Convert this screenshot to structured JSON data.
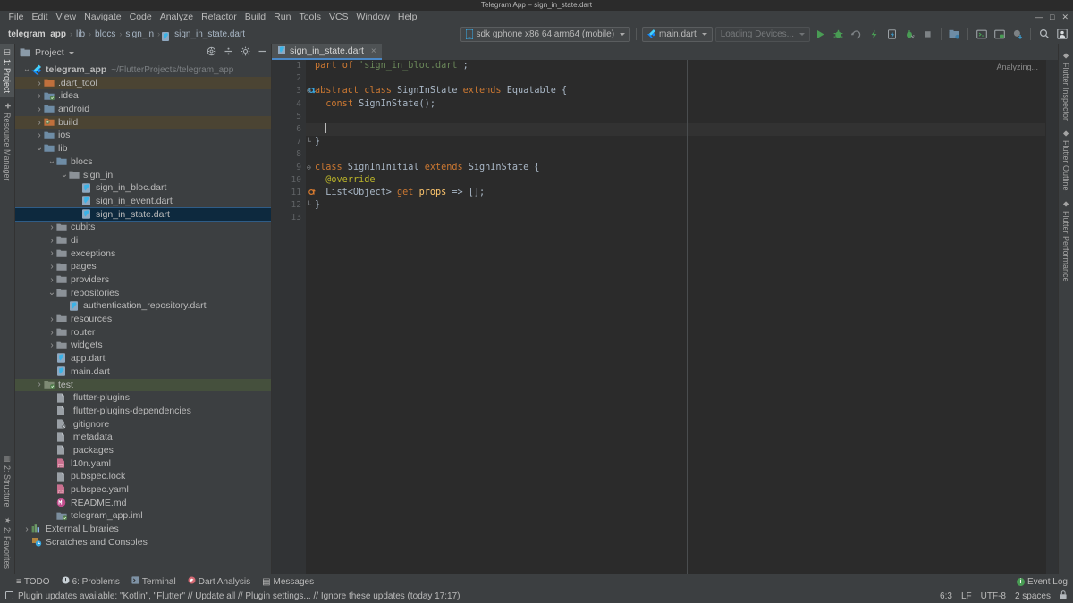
{
  "window": {
    "title": "Telegram App – sign_in_state.dart",
    "controls": [
      "minimize",
      "maximize",
      "close"
    ]
  },
  "menubar": {
    "items": [
      "File",
      "Edit",
      "View",
      "Navigate",
      "Code",
      "Analyze",
      "Refactor",
      "Build",
      "Run",
      "Tools",
      "VCS",
      "Window",
      "Help"
    ]
  },
  "breadcrumb": {
    "items": [
      "telegram_app",
      "lib",
      "blocs",
      "sign_in",
      "sign_in_state.dart"
    ],
    "separator": "›"
  },
  "toolbar": {
    "device_selector": "sdk gphone x86 64 arm64 (mobile)",
    "run_config": "main.dart",
    "devices_status": "Loading Devices...",
    "icons": [
      "run-icon",
      "debug-icon",
      "debug-reattach-icon",
      "hot-reload-icon",
      "open-devtools-icon",
      "profile-icon",
      "stop-icon",
      "project-structure-icon",
      "terminal-icon",
      "flutter-inspector-icon",
      "update-project-icon",
      "search-everywhere-icon",
      "account-icon"
    ]
  },
  "left_rail": {
    "top": [
      {
        "label": "1: Project",
        "icon": "project-icon",
        "active": true
      },
      {
        "label": "Resource Manager",
        "icon": "resource-icon",
        "active": false
      }
    ],
    "bottom": [
      {
        "label": "2: Structure",
        "icon": "structure-icon"
      },
      {
        "label": "2: Favorites",
        "icon": "star-icon"
      }
    ]
  },
  "right_rail": {
    "items": [
      {
        "label": "Flutter Inspector",
        "icon": "flutter-icon"
      },
      {
        "label": "Flutter Outline",
        "icon": "flutter-icon"
      },
      {
        "label": "Flutter Performance",
        "icon": "flutter-icon"
      }
    ]
  },
  "project_panel": {
    "title": "Project",
    "tools": [
      "collapse-scope-icon",
      "collapse-all-icon",
      "settings-icon",
      "hide-icon"
    ],
    "tree": [
      {
        "label": "telegram_app",
        "sub": "~/FlutterProjects/telegram_app",
        "depth": 0,
        "arrow": "open",
        "icon": "flutter-project-icon",
        "bold": true,
        "highlight": ""
      },
      {
        "label": ".dart_tool",
        "depth": 1,
        "arrow": "closed",
        "icon": "folder-orange",
        "highlight": "brown"
      },
      {
        "label": ".idea",
        "depth": 1,
        "arrow": "closed",
        "icon": "folder-module",
        "highlight": ""
      },
      {
        "label": "android",
        "depth": 1,
        "arrow": "closed",
        "icon": "folder-blue",
        "highlight": ""
      },
      {
        "label": "build",
        "depth": 1,
        "arrow": "closed",
        "icon": "folder-orange-excluded",
        "highlight": "brown"
      },
      {
        "label": "ios",
        "depth": 1,
        "arrow": "closed",
        "icon": "folder-blue",
        "highlight": ""
      },
      {
        "label": "lib",
        "depth": 1,
        "arrow": "open",
        "icon": "folder-blue",
        "highlight": ""
      },
      {
        "label": "blocs",
        "depth": 2,
        "arrow": "open",
        "icon": "folder-blue",
        "highlight": ""
      },
      {
        "label": "sign_in",
        "depth": 3,
        "arrow": "open",
        "icon": "folder-gray",
        "highlight": ""
      },
      {
        "label": "sign_in_bloc.dart",
        "depth": 4,
        "arrow": "",
        "icon": "dart-file",
        "highlight": ""
      },
      {
        "label": "sign_in_event.dart",
        "depth": 4,
        "arrow": "",
        "icon": "dart-file",
        "highlight": ""
      },
      {
        "label": "sign_in_state.dart",
        "depth": 4,
        "arrow": "",
        "icon": "dart-file",
        "highlight": "",
        "selected": true
      },
      {
        "label": "cubits",
        "depth": 2,
        "arrow": "closed",
        "icon": "folder-gray",
        "highlight": ""
      },
      {
        "label": "di",
        "depth": 2,
        "arrow": "closed",
        "icon": "folder-gray",
        "highlight": ""
      },
      {
        "label": "exceptions",
        "depth": 2,
        "arrow": "closed",
        "icon": "folder-gray",
        "highlight": ""
      },
      {
        "label": "pages",
        "depth": 2,
        "arrow": "closed",
        "icon": "folder-gray",
        "highlight": ""
      },
      {
        "label": "providers",
        "depth": 2,
        "arrow": "closed",
        "icon": "folder-gray",
        "highlight": ""
      },
      {
        "label": "repositories",
        "depth": 2,
        "arrow": "open",
        "icon": "folder-gray",
        "highlight": ""
      },
      {
        "label": "authentication_repository.dart",
        "depth": 3,
        "arrow": "",
        "icon": "dart-file",
        "highlight": ""
      },
      {
        "label": "resources",
        "depth": 2,
        "arrow": "closed",
        "icon": "folder-gray",
        "highlight": ""
      },
      {
        "label": "router",
        "depth": 2,
        "arrow": "closed",
        "icon": "folder-gray",
        "highlight": ""
      },
      {
        "label": "widgets",
        "depth": 2,
        "arrow": "closed",
        "icon": "folder-gray",
        "highlight": ""
      },
      {
        "label": "app.dart",
        "depth": 2,
        "arrow": "",
        "icon": "dart-file",
        "highlight": ""
      },
      {
        "label": "main.dart",
        "depth": 2,
        "arrow": "",
        "icon": "dart-file",
        "highlight": ""
      },
      {
        "label": "test",
        "depth": 1,
        "arrow": "closed",
        "icon": "folder-test",
        "highlight": "green"
      },
      {
        "label": ".flutter-plugins",
        "depth": 2,
        "arrow": "",
        "icon": "text-file",
        "highlight": ""
      },
      {
        "label": ".flutter-plugins-dependencies",
        "depth": 2,
        "arrow": "",
        "icon": "text-file",
        "highlight": ""
      },
      {
        "label": ".gitignore",
        "depth": 2,
        "arrow": "",
        "icon": "gitignore-file",
        "highlight": ""
      },
      {
        "label": ".metadata",
        "depth": 2,
        "arrow": "",
        "icon": "text-file",
        "highlight": ""
      },
      {
        "label": ".packages",
        "depth": 2,
        "arrow": "",
        "icon": "text-file",
        "highlight": ""
      },
      {
        "label": "l10n.yaml",
        "depth": 2,
        "arrow": "",
        "icon": "yaml-file",
        "highlight": ""
      },
      {
        "label": "pubspec.lock",
        "depth": 2,
        "arrow": "",
        "icon": "text-file",
        "highlight": ""
      },
      {
        "label": "pubspec.yaml",
        "depth": 2,
        "arrow": "",
        "icon": "yaml-file",
        "highlight": ""
      },
      {
        "label": "README.md",
        "depth": 2,
        "arrow": "",
        "icon": "md-file",
        "highlight": ""
      },
      {
        "label": "telegram_app.iml",
        "depth": 2,
        "arrow": "",
        "icon": "iml-file",
        "highlight": ""
      },
      {
        "label": "External Libraries",
        "depth": 0,
        "arrow": "closed",
        "icon": "libraries-icon",
        "highlight": ""
      },
      {
        "label": "Scratches and Consoles",
        "depth": 0,
        "arrow": "",
        "icon": "scratches-icon",
        "highlight": ""
      }
    ]
  },
  "editor": {
    "tab": {
      "label": "sign_in_state.dart",
      "icon": "dart-file",
      "close": "×"
    },
    "status_hint": "Analyzing...",
    "lines": [
      {
        "n": "1",
        "tokens": [
          {
            "t": "part",
            "c": "kw"
          },
          {
            "t": " ",
            "c": "pun"
          },
          {
            "t": "of",
            "c": "kw"
          },
          {
            "t": " ",
            "c": "pun"
          },
          {
            "t": "'sign_in_bloc.dart'",
            "c": "str"
          },
          {
            "t": ";",
            "c": "pun"
          }
        ]
      },
      {
        "n": "2",
        "tokens": []
      },
      {
        "n": "3",
        "tokens": [
          {
            "t": "abstract",
            "c": "kw"
          },
          {
            "t": " ",
            "c": "pun"
          },
          {
            "t": "class",
            "c": "kw"
          },
          {
            "t": " SignInState ",
            "c": "typ"
          },
          {
            "t": "extends",
            "c": "kw"
          },
          {
            "t": " Equatable {",
            "c": "typ"
          }
        ],
        "gutter_mark": "implemented-icon",
        "fold": "open"
      },
      {
        "n": "4",
        "tokens": [
          {
            "t": "  ",
            "c": "pun"
          },
          {
            "t": "const",
            "c": "kw"
          },
          {
            "t": " SignInState();",
            "c": "typ"
          }
        ]
      },
      {
        "n": "5",
        "tokens": []
      },
      {
        "n": "6",
        "tokens": [
          {
            "t": "  ",
            "c": "pun"
          }
        ],
        "current": true,
        "caret": true
      },
      {
        "n": "7",
        "tokens": [
          {
            "t": "}",
            "c": "pun"
          }
        ],
        "fold": "end"
      },
      {
        "n": "8",
        "tokens": []
      },
      {
        "n": "9",
        "tokens": [
          {
            "t": "class",
            "c": "kw"
          },
          {
            "t": " SignInInitial ",
            "c": "typ"
          },
          {
            "t": "extends",
            "c": "kw"
          },
          {
            "t": " SignInState {",
            "c": "typ"
          }
        ],
        "fold": "open"
      },
      {
        "n": "10",
        "tokens": [
          {
            "t": "  ",
            "c": "pun"
          },
          {
            "t": "@override",
            "c": "ann"
          }
        ]
      },
      {
        "n": "11",
        "tokens": [
          {
            "t": "  List<Object> ",
            "c": "typ"
          },
          {
            "t": "get",
            "c": "kw"
          },
          {
            "t": " ",
            "c": "pun"
          },
          {
            "t": "props",
            "c": "fn"
          },
          {
            "t": " => [];",
            "c": "typ"
          }
        ],
        "gutter_mark": "override-icon"
      },
      {
        "n": "12",
        "tokens": [
          {
            "t": "}",
            "c": "pun"
          }
        ],
        "fold": "end"
      },
      {
        "n": "13",
        "tokens": []
      }
    ]
  },
  "tool_windows": [
    {
      "label": "TODO",
      "icon": "todo-icon"
    },
    {
      "label": "6: Problems",
      "icon": "problems-icon",
      "count": "6"
    },
    {
      "label": "Terminal",
      "icon": "terminal-icon"
    },
    {
      "label": "Dart Analysis",
      "icon": "dart-analysis-icon"
    },
    {
      "label": "Messages",
      "icon": "messages-icon"
    }
  ],
  "event_log": {
    "label": "Event Log",
    "badge": "i"
  },
  "statusbar": {
    "message": "Plugin updates available: \"Kotlin\", \"Flutter\" // Update all // Plugin settings... // Ignore these updates (today 17:17)",
    "icon": "notification-icon",
    "caret_position": "6:3",
    "line_separator": "LF",
    "encoding": "UTF-8",
    "indent": "2 spaces",
    "lock_icon": "read-only-icon"
  },
  "colors": {
    "bg_panel": "#3c3f41",
    "bg_editor": "#2b2b2b",
    "selection": "#0d293e",
    "accent_blue": "#4a88c7",
    "keyword": "#cc7832",
    "string": "#6a8759",
    "annotation": "#bbb529",
    "function": "#ffc66d",
    "text": "#a9b7c6",
    "green_run": "#499c54"
  }
}
